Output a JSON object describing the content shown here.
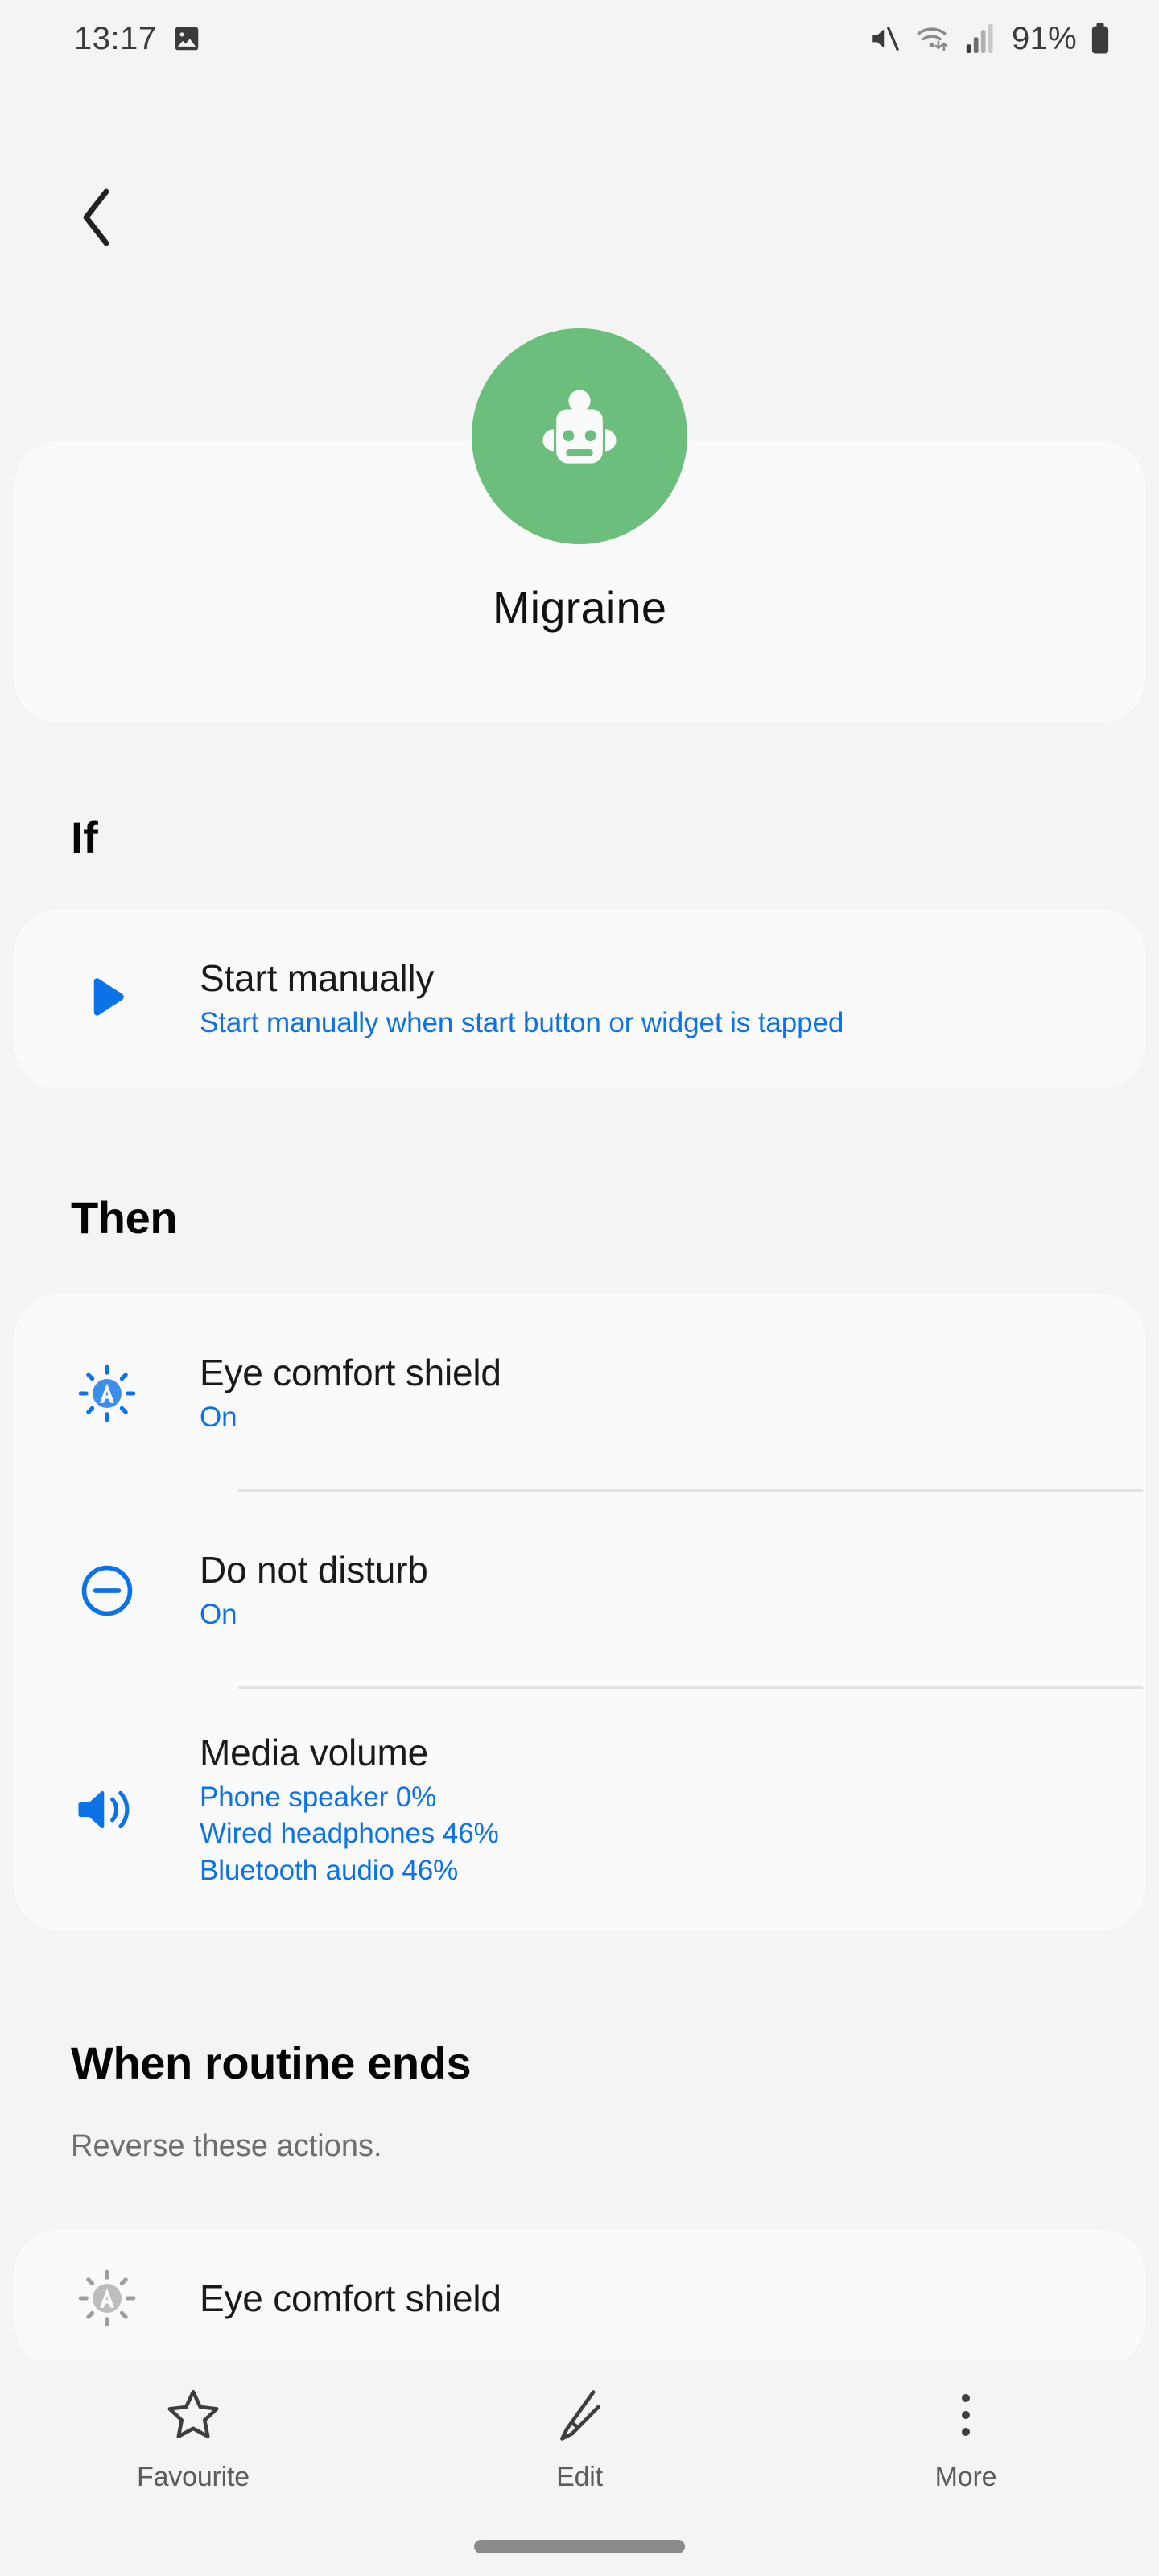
{
  "status_bar": {
    "time": "13:17",
    "battery_percent": "91%",
    "icons": [
      "image-icon",
      "volume-off-icon",
      "wifi-icon",
      "signal-bars-icon",
      "battery-icon"
    ]
  },
  "header": {
    "back_icon": "back-chevron-icon",
    "avatar_icon": "robot-icon",
    "avatar_color": "#6CBE7C",
    "title": "Migraine"
  },
  "sections": {
    "if": {
      "heading": "If",
      "rows": [
        {
          "icon": "play-icon",
          "title": "Start manually",
          "subtitle_lines": [
            "Start manually when start button or widget is tapped"
          ],
          "dimmed": false
        }
      ]
    },
    "then": {
      "heading": "Then",
      "rows": [
        {
          "icon": "eye-comfort-shield-icon",
          "title": "Eye comfort shield",
          "subtitle_lines": [
            "On"
          ],
          "dimmed": false
        },
        {
          "icon": "do-not-disturb-icon",
          "title": "Do not disturb",
          "subtitle_lines": [
            "On"
          ],
          "dimmed": false
        },
        {
          "icon": "media-volume-icon",
          "title": "Media volume",
          "subtitle_lines": [
            "Phone speaker 0%",
            "Wired headphones 46%",
            "Bluetooth audio 46%"
          ],
          "dimmed": false
        }
      ]
    },
    "when_routine_ends": {
      "heading": "When routine ends",
      "subheading": "Reverse these actions.",
      "rows": [
        {
          "icon": "eye-comfort-shield-icon",
          "title": "Eye comfort shield",
          "subtitle_lines": [],
          "dimmed": true
        }
      ]
    }
  },
  "bottom_nav": [
    {
      "icon": "star-outline-icon",
      "label": "Favourite"
    },
    {
      "icon": "pencil-icon",
      "label": "Edit"
    },
    {
      "icon": "more-vertical-icon",
      "label": "More"
    }
  ],
  "colors": {
    "background": "#F4F4F4",
    "card": "#FAFAFA",
    "accent_blue": "#0C72E8",
    "avatar_green": "#6CBE7C",
    "divider": "#E2E2E2"
  }
}
